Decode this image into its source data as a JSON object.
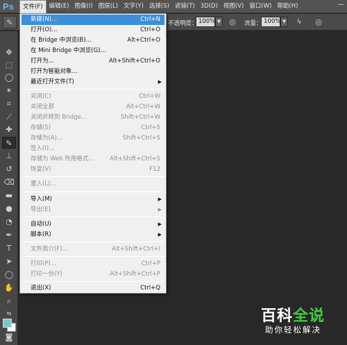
{
  "app": {
    "logo": "Ps"
  },
  "menubar": {
    "items": [
      "文件(F)",
      "编辑(E)",
      "图像(I)",
      "图层(L)",
      "文字(Y)",
      "选择(S)",
      "滤镜(T)",
      "3D(D)",
      "视图(V)",
      "窗口(W)",
      "帮助(H)"
    ],
    "window_controls": [
      "—",
      "□",
      "✕"
    ]
  },
  "options_bar": {
    "opacity_label": "不透明度：",
    "opacity_value": "100%",
    "flow_label": "流量：",
    "flow_value": "100%"
  },
  "file_menu": {
    "items": [
      {
        "label": "新建(N)...",
        "shortcut": "Ctrl+N",
        "state": "highlighted"
      },
      {
        "label": "打开(O)...",
        "shortcut": "Ctrl+O",
        "state": "enabled"
      },
      {
        "label": "在 Bridge 中浏览(B)...",
        "shortcut": "Alt+Ctrl+O",
        "state": "enabled"
      },
      {
        "label": "在 Mini Bridge 中浏览(G)...",
        "shortcut": "",
        "state": "enabled"
      },
      {
        "label": "打开为...",
        "shortcut": "Alt+Shift+Ctrl+O",
        "state": "enabled"
      },
      {
        "label": "打开为智能对象...",
        "shortcut": "",
        "state": "enabled"
      },
      {
        "label": "最近打开文件(T)",
        "shortcut": "",
        "state": "enabled",
        "submenu": true
      },
      {
        "label": "关闭(C)",
        "shortcut": "Ctrl+W",
        "state": "disabled"
      },
      {
        "label": "关闭全部",
        "shortcut": "Alt+Ctrl+W",
        "state": "disabled"
      },
      {
        "label": "关闭并转到 Bridge...",
        "shortcut": "Shift+Ctrl+W",
        "state": "disabled"
      },
      {
        "label": "存储(S)",
        "shortcut": "Ctrl+S",
        "state": "disabled"
      },
      {
        "label": "存储为(A)...",
        "shortcut": "Shift+Ctrl+S",
        "state": "disabled"
      },
      {
        "label": "签入(I)...",
        "shortcut": "",
        "state": "disabled"
      },
      {
        "label": "存储为 Web 所用格式...",
        "shortcut": "Alt+Shift+Ctrl+S",
        "state": "disabled"
      },
      {
        "label": "恢复(V)",
        "shortcut": "F12",
        "state": "disabled"
      },
      {
        "label": "置入(L)...",
        "shortcut": "",
        "state": "disabled"
      },
      {
        "label": "导入(M)",
        "shortcut": "",
        "state": "enabled",
        "submenu": true
      },
      {
        "label": "导出(E)",
        "shortcut": "",
        "state": "disabled",
        "submenu": true
      },
      {
        "label": "自动(U)",
        "shortcut": "",
        "state": "enabled",
        "submenu": true
      },
      {
        "label": "脚本(R)",
        "shortcut": "",
        "state": "enabled",
        "submenu": true
      },
      {
        "label": "文件简介(F)...",
        "shortcut": "Alt+Shift+Ctrl+I",
        "state": "disabled"
      },
      {
        "label": "打印(P)...",
        "shortcut": "Ctrl+P",
        "state": "disabled"
      },
      {
        "label": "打印一份(Y)",
        "shortcut": "Alt+Shift+Ctrl+P",
        "state": "disabled"
      },
      {
        "label": "退出(X)",
        "shortcut": "Ctrl+Q",
        "state": "enabled"
      }
    ]
  },
  "watermark": {
    "title_a": "百科",
    "title_b": "全说",
    "subtitle": "助你轻松解决"
  },
  "colors": {
    "highlight": "#3c8fd8",
    "foreground_swatch": "#7ec6c6",
    "background_swatch": "#ffffff"
  }
}
